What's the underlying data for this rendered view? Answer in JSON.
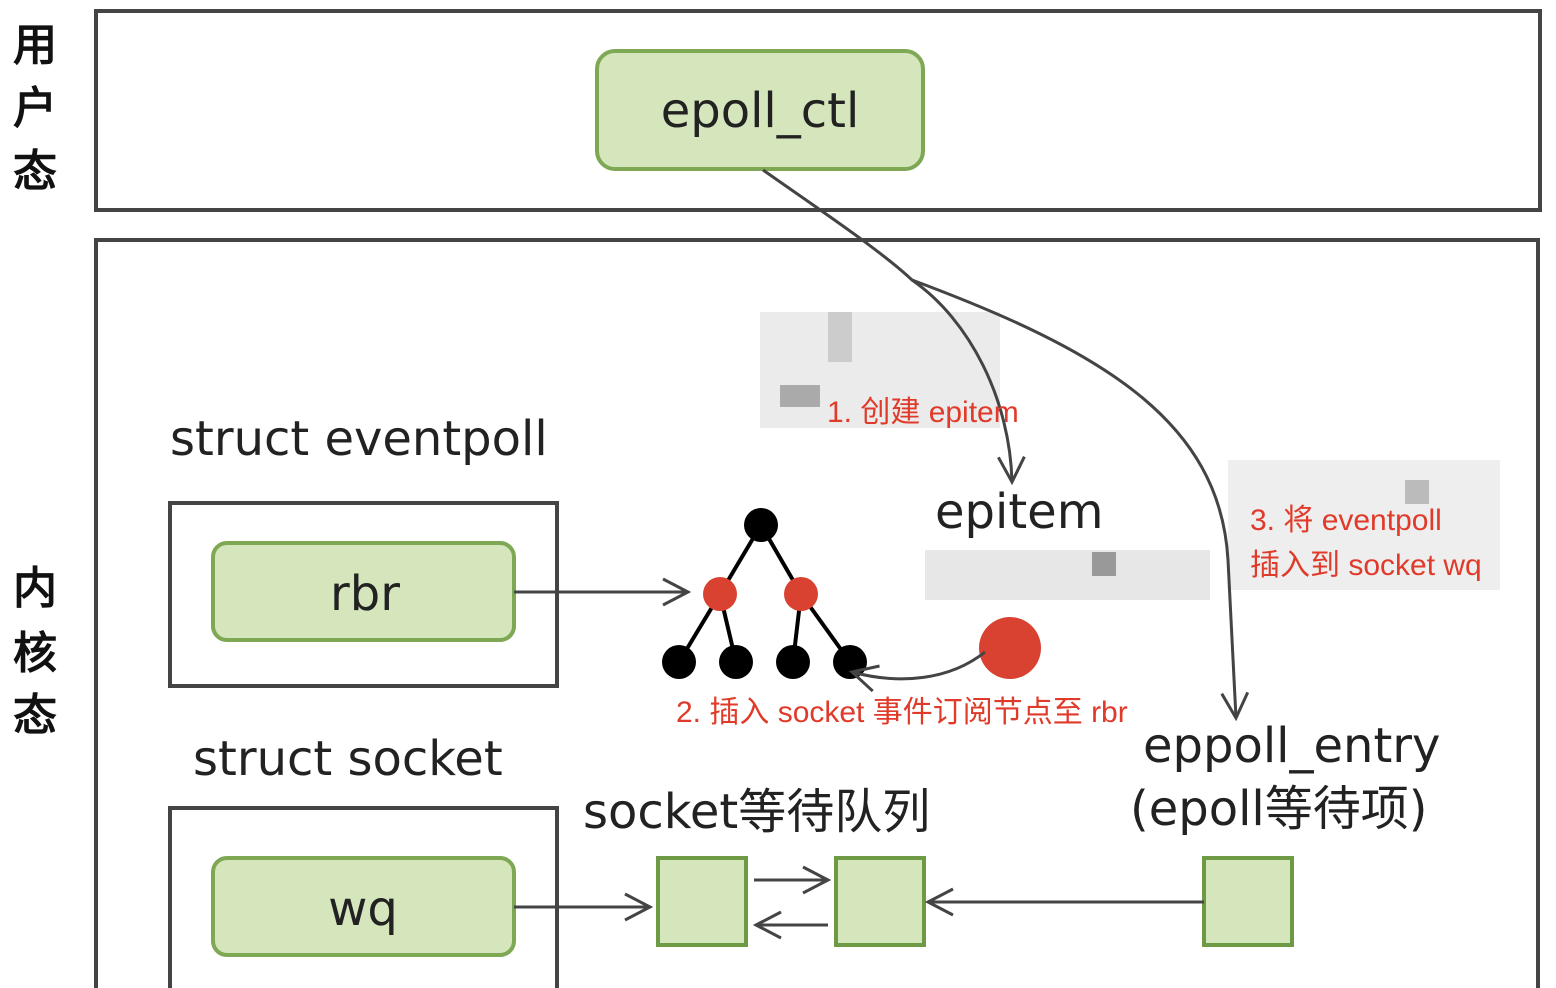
{
  "side_labels": {
    "user": [
      "用",
      "户",
      "态"
    ],
    "kernel": [
      "内",
      "核",
      "态"
    ]
  },
  "nodes": {
    "epoll_ctl": "epoll_ctl",
    "struct_eventpoll": "struct eventpoll",
    "rbr": "rbr",
    "epitem": "epitem",
    "struct_socket": "struct socket",
    "wq": "wq",
    "socket_wait_queue": "socket等待队列",
    "eppoll_entry": "eppoll_entry",
    "eppoll_entry_desc": "(epoll等待项)"
  },
  "annotations": {
    "step1": "1. 创建 epitem",
    "step2": "2. 插入 socket 事件订阅节点至 rbr",
    "step3_line1": "3. 将 eventpoll",
    "step3_line2": "插入到 socket wq"
  },
  "colors": {
    "node_fill": "#d5e6bd",
    "node_stroke": "#7fa855",
    "red_node": "#d94130",
    "black_node": "#000000",
    "annotation": "#e03a2a"
  }
}
